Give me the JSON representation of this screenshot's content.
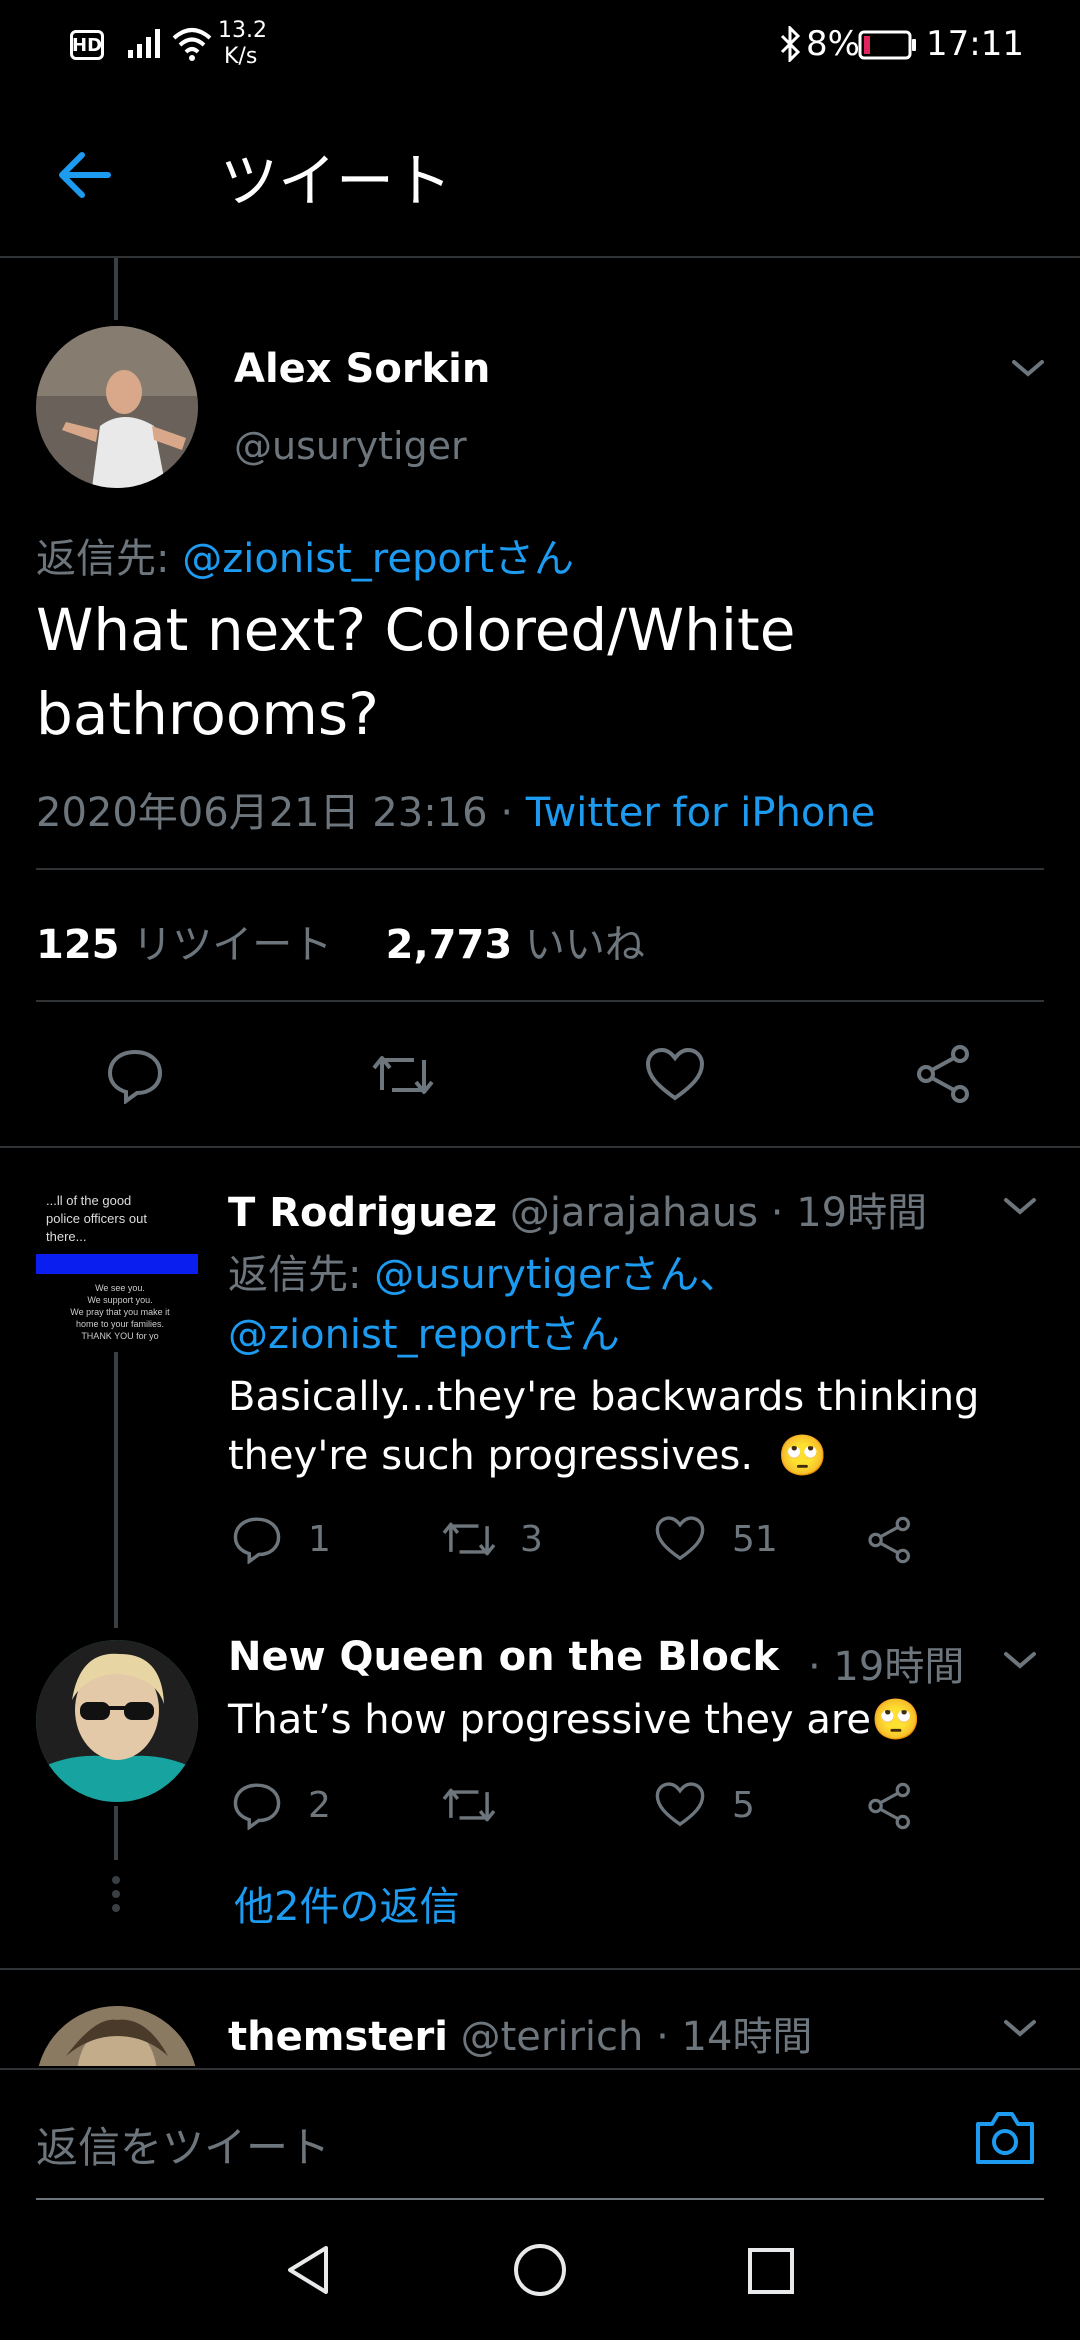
{
  "status_bar": {
    "left_badge": "HD",
    "speed_value": "13.2",
    "speed_unit": "K/s",
    "battery": "8%",
    "time": "17:11"
  },
  "header": {
    "title": "ツイート"
  },
  "main_tweet": {
    "name": "Alex Sorkin",
    "handle": "@usurytiger",
    "reply_to_label": "返信先:",
    "reply_to_handle": "@zionist_reportさん",
    "text_line1": "What next? Colored/White",
    "text_line2": "bathrooms?",
    "date": "2020年06月21日 23:16",
    "separator": "·",
    "source": "Twitter for iPhone",
    "retweet_count": "125",
    "retweet_label": "リツイート",
    "like_count": "2,773",
    "like_label": "いいね"
  },
  "replies": [
    {
      "name": "T Rodriguez",
      "handle": "@jarajahaus",
      "time": "· 19時間",
      "reply_to_label": "返信先:",
      "reply_to_handle1": "@usurytigerさん、",
      "reply_to_handle2": "@zionist_reportさん",
      "text_line1": "Basically...they're backwards thinking",
      "text_line2": "they're such progressives.",
      "emoji": "🙄",
      "reply_count": "1",
      "retweet_count": "3",
      "like_count": "51",
      "avatar_text_line1": "...ll of the good",
      "avatar_text_line2": "police officers out",
      "avatar_text_line3": "there...",
      "avatar_text_line4": "We see you.",
      "avatar_text_line5": "We support you.",
      "avatar_text_line6": "We pray that you make it",
      "avatar_text_line7": "home to your families.",
      "avatar_text_line8": "THANK YOU for yo"
    },
    {
      "name": "New Queen on the Block",
      "time": "· 19時間",
      "text": "That’s how progressive they are",
      "emoji": "🙄",
      "reply_count": "2",
      "like_count": "5"
    }
  ],
  "more_replies": "他2件の返信",
  "third_reply": {
    "name": "themsteri",
    "handle": "@teririch",
    "time": "· 14時間"
  },
  "composer": {
    "placeholder": "返信をツイート"
  },
  "colors": {
    "accent": "#1d9bf0",
    "background": "#000000",
    "muted": "#6e767d"
  }
}
